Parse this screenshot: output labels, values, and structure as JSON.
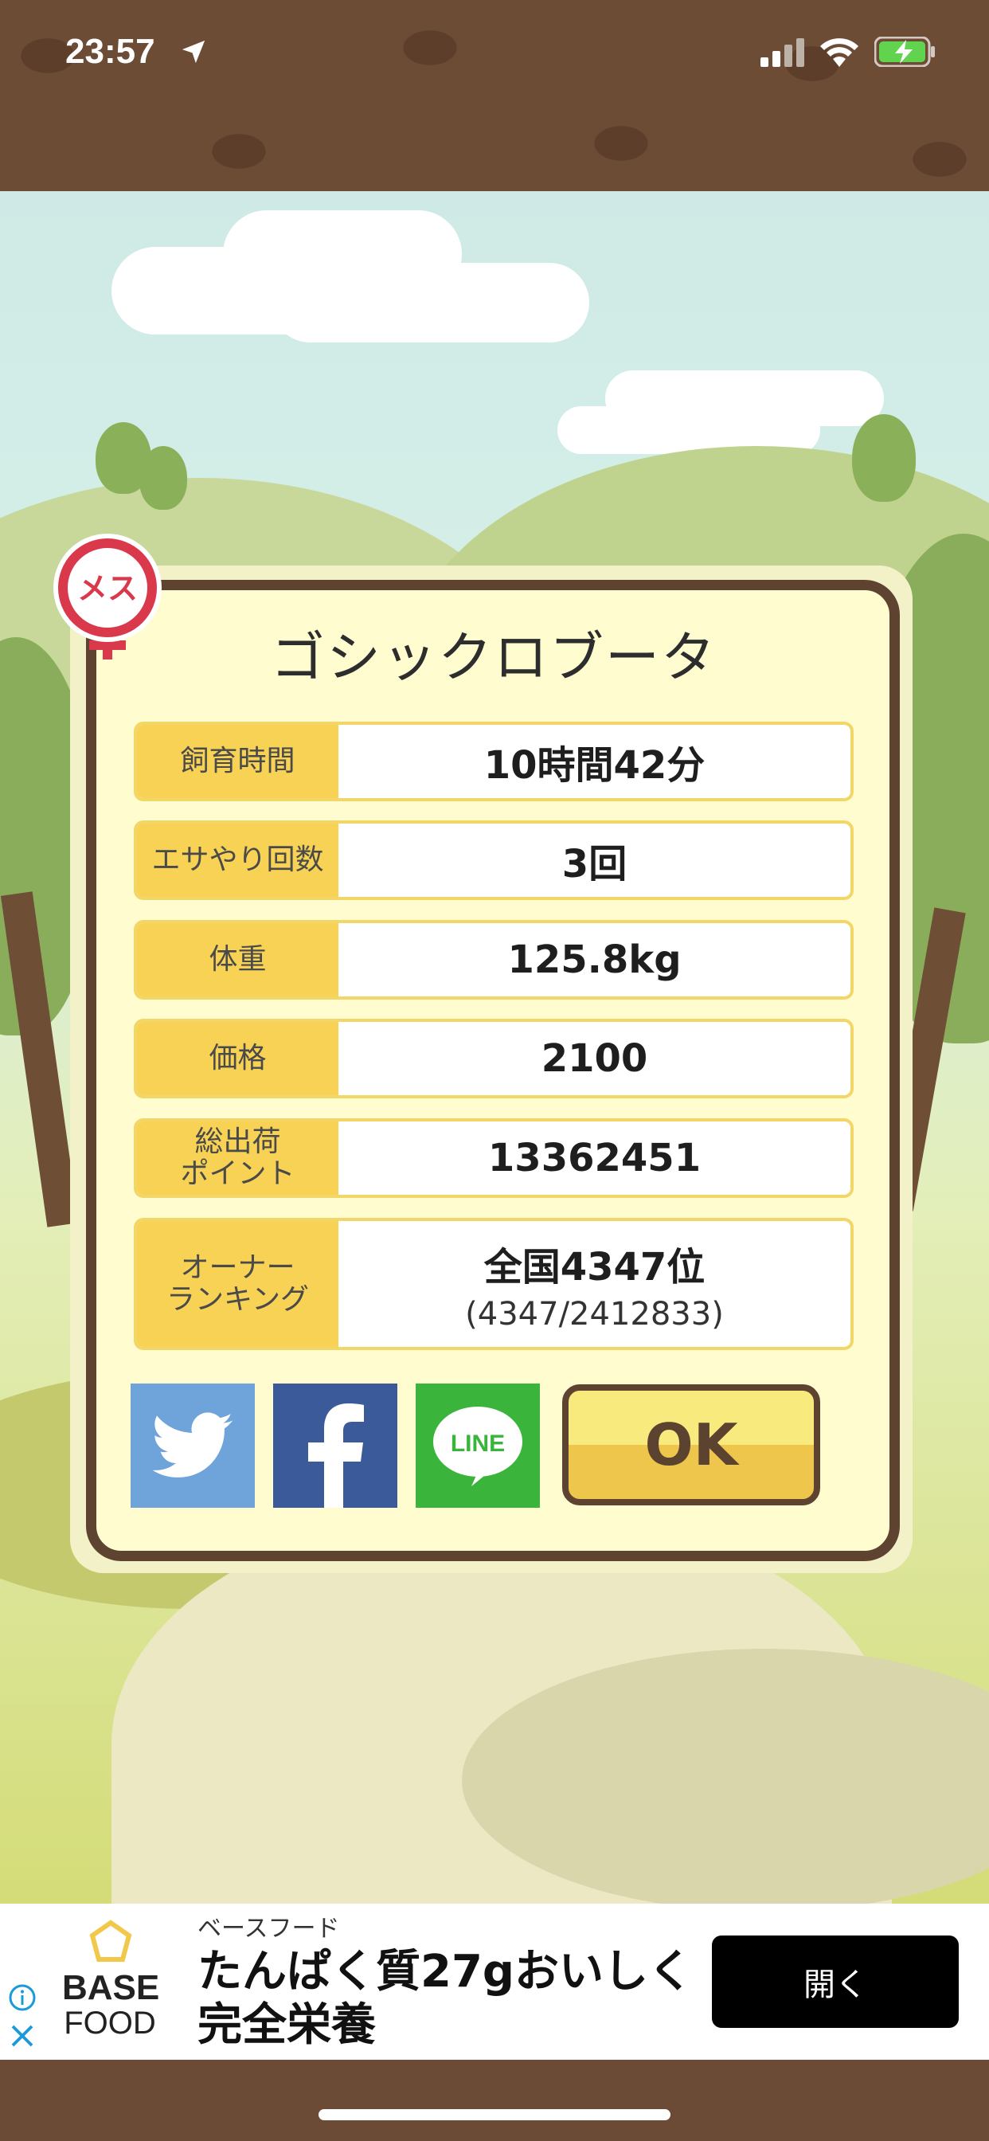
{
  "status_bar": {
    "time": "23:57",
    "icons": [
      "location-arrow-icon",
      "signal-icon",
      "wifi-icon",
      "battery-charging-icon"
    ]
  },
  "dialog": {
    "badge": {
      "text": "メス",
      "icon": "female-symbol-icon"
    },
    "title": "ゴシックロブータ",
    "rows": [
      {
        "label": "飼育時間",
        "value": "10時間42分"
      },
      {
        "label": "エサやり回数",
        "value": "3回"
      },
      {
        "label": "体重",
        "value": "125.8kg"
      },
      {
        "label": "価格",
        "value": "2100"
      },
      {
        "label_line1": "総出荷",
        "label_line2": "ポイント",
        "value": "13362451"
      },
      {
        "label_line1": "オーナー",
        "label_line2": "ランキング",
        "value": "全国4347位",
        "sub_value": "(4347/2412833)"
      }
    ],
    "share": {
      "twitter_icon": "twitter-bird-icon",
      "facebook_icon": "facebook-f-icon",
      "line_icon": "line-bubble-icon",
      "line_text": "LINE"
    },
    "ok_label": "OK"
  },
  "ad": {
    "logo_line1": "BASE",
    "logo_line2": "FOOD",
    "advertiser": "ベースフード",
    "headline_line1": "たんぱく質27gおいしく",
    "headline_line2": "完全栄養",
    "cta_label": "開く"
  },
  "colors": {
    "brown": "#6d4c36",
    "dialog_border": "#5f4331",
    "label_yellow": "#f7d255",
    "twitter": "#6fa4db",
    "facebook": "#3b5a99",
    "line": "#3ab43b"
  }
}
